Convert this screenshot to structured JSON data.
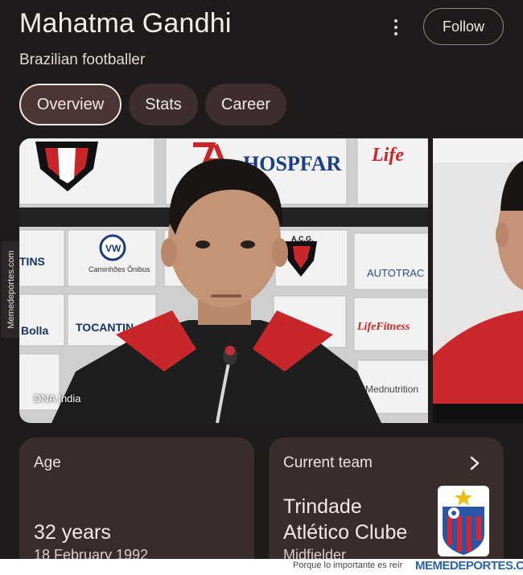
{
  "header": {
    "title": "Mahatma Gandhi",
    "subtitle": "Brazilian footballer",
    "follow_label": "Follow"
  },
  "tabs": [
    {
      "label": "Overview",
      "active": true
    },
    {
      "label": "Stats",
      "active": false
    },
    {
      "label": "Career",
      "active": false
    }
  ],
  "media": {
    "credit": "DNA India",
    "sponsor_boards": [
      "HOSPFAR",
      "TINS",
      "Caminhões Ônibus",
      "A.C.G.",
      "AUTOTRAC",
      "Bolla",
      "TOCANTIN",
      "LifeFitness",
      "Mednutrition"
    ]
  },
  "cards": {
    "age": {
      "label": "Age",
      "value": "32 years",
      "sub": "18 February 1992"
    },
    "team": {
      "label": "Current team",
      "name_line1": "Trindade",
      "name_line2": "Atlético Clube",
      "position": "Midfielder"
    }
  },
  "watermark": {
    "side": "Memedeportes.com",
    "tagline": "Porque lo importante es reír",
    "brand": "MEMEDEPORTES.COM"
  },
  "colors": {
    "background": "#1f1b1b",
    "chip": "#3e2f2e",
    "card": "#3a2c2b",
    "brand_blue": "#2a63a8"
  }
}
